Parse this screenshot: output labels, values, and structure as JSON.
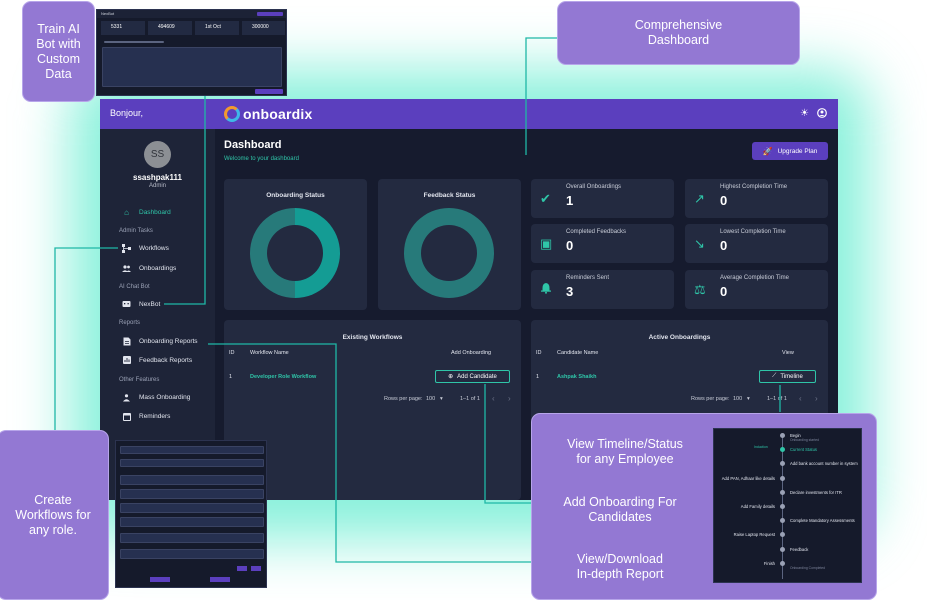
{
  "app": {
    "greeting": "Bonjour,",
    "brand": "onboardix",
    "user": {
      "initials": "SS",
      "name": "ssashpak111",
      "role": "Admin"
    },
    "page_title": "Dashboard",
    "page_subtitle": "Welcome to your dashboard",
    "upgrade_label": "Upgrade Plan",
    "icons": {
      "theme": "sun-icon",
      "account": "user-circle-icon"
    }
  },
  "sidebar": {
    "dashboard": "Dashboard",
    "sections": [
      "Admin Tasks",
      "AI Chat Bot",
      "Reports",
      "Other Features"
    ],
    "admin_tasks": [
      "Workflows",
      "Onboardings"
    ],
    "ai_chat_bot": [
      "NexBot"
    ],
    "reports": [
      "Onboarding Reports",
      "Feedback Reports"
    ],
    "other_features": [
      "Mass Onboarding",
      "Reminders"
    ]
  },
  "status_cards": [
    {
      "title": "Onboarding Status",
      "fill_fraction": 0.5
    },
    {
      "title": "Feedback Status",
      "fill_fraction": 0
    }
  ],
  "stats": [
    {
      "label": "Overall Onboardings",
      "value": "1",
      "icon": "double-check-icon"
    },
    {
      "label": "Highest Completion Time",
      "value": "0",
      "icon": "trending-up-icon"
    },
    {
      "label": "Completed Feedbacks",
      "value": "0",
      "icon": "feedback-icon"
    },
    {
      "label": "Lowest Completion Time",
      "value": "0",
      "icon": "trending-down-icon"
    },
    {
      "label": "Reminders Sent",
      "value": "3",
      "icon": "bell-icon"
    },
    {
      "label": "Average Completion Time",
      "value": "0",
      "icon": "scale-icon"
    }
  ],
  "workflows_table": {
    "title": "Existing Workflows",
    "headers": [
      "ID",
      "Workflow Name",
      "Add Onboarding"
    ],
    "row": {
      "id": "1",
      "name": "Developer Role Workflow",
      "action": "Add Candidate"
    },
    "rows_per_page_label": "Rows per page:",
    "rows_per_page": "100",
    "range": "1–1 of 1"
  },
  "onboardings_table": {
    "title": "Active Onboardings",
    "headers": [
      "ID",
      "Candidate Name",
      "View"
    ],
    "row": {
      "id": "1",
      "name": "Ashpak Shaikh",
      "action": "Timeline"
    },
    "rows_per_page_label": "Rows per page:",
    "rows_per_page": "100",
    "range": "1–1 of 1"
  },
  "callouts": {
    "train_bot": [
      "Train AI",
      "Bot with",
      "Custom",
      "Data"
    ],
    "dashboard": [
      "Comprehensive",
      "Dashboard"
    ],
    "workflows": [
      "Create",
      "Workflows for",
      "any role."
    ],
    "timeline": [
      "View Timeline/Status",
      "for any Employee"
    ],
    "add_onboarding": [
      "Add Onboarding For",
      "Candidates"
    ],
    "report": [
      "View/Download",
      "In-depth Report"
    ]
  },
  "nexbot_shot": {
    "title": "NexBot",
    "stats": [
      "5331",
      "494609",
      "1st Oct",
      "300000"
    ]
  },
  "timeline_shot": {
    "steps": [
      {
        "label": "Begin",
        "sub": "Onboarding started"
      },
      {
        "label": "Current Status",
        "sub": ""
      },
      {
        "label": "Add bank account number in system",
        "sub": ""
      },
      {
        "label": "Add PAN, Adhaar like details",
        "sub": ""
      },
      {
        "label": "Declare investments for ITR",
        "sub": ""
      },
      {
        "label": "Add Family details",
        "sub": ""
      },
      {
        "label": "Complete Mandatory Assessments",
        "sub": ""
      },
      {
        "label": "Raise Laptop Request",
        "sub": ""
      },
      {
        "label": "Feedback",
        "sub": ""
      },
      {
        "label": "Finish",
        "sub": "Onboarding Completed"
      }
    ],
    "active_step_note": "Induction"
  }
}
